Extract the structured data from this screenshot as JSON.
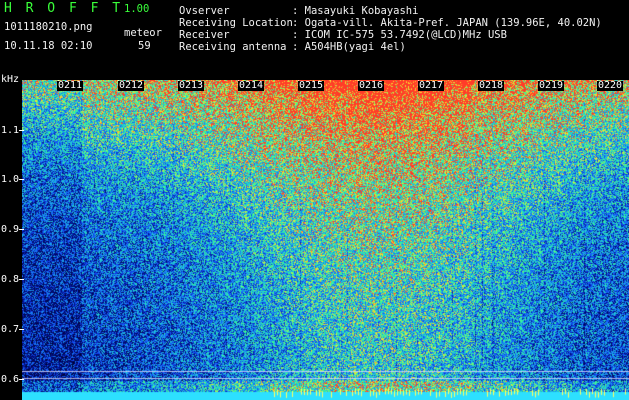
{
  "header": {
    "app_name": "H R O F F T",
    "version": "1.00",
    "filename": "1011180210.png",
    "datetime": "10.11.18 02:10",
    "meteor_label": "meteor",
    "meteor_count": "59"
  },
  "info": [
    {
      "label": "Ovserver",
      "value": ": Masayuki Kobayashi"
    },
    {
      "label": "Receiving Location",
      "value": ": Ogata-vill. Akita-Pref. JAPAN (139.96E, 40.02N)"
    },
    {
      "label": "Receiver",
      "value": ": ICOM IC-575 53.7492(@LCD)MHz USB"
    },
    {
      "label": "Receiving antenna",
      "value": ": A504HB(yagi 4el)"
    }
  ],
  "spectrogram": {
    "unit_label": "kHz",
    "freq_labels": [
      "1.1",
      "1.0",
      "0.9",
      "0.8",
      "0.7",
      "0.6"
    ],
    "time_labels": [
      "0211",
      "0212",
      "0213",
      "0214",
      "0215",
      "0216",
      "0217",
      "0218",
      "0219",
      "0220"
    ],
    "colors": {
      "low": "#00003a",
      "mid": "#1e5cff",
      "high": "#2dffb4",
      "peak": "#ffe030"
    }
  }
}
